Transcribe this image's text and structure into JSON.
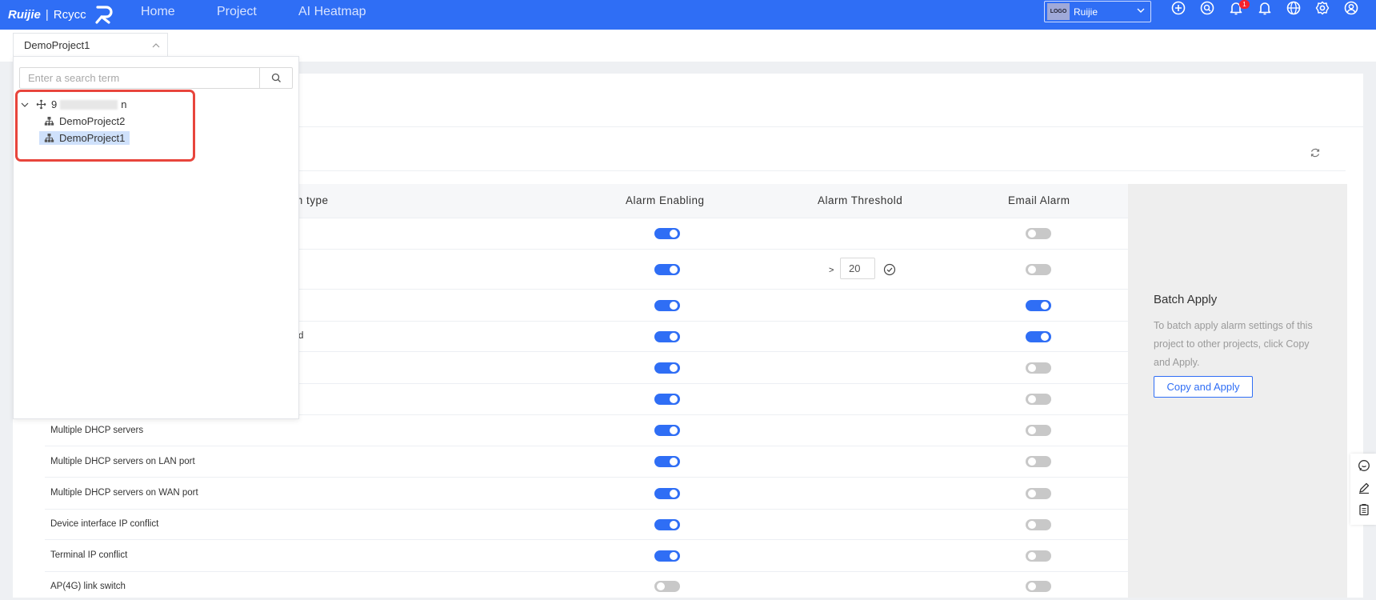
{
  "topbar": {
    "brand": "Ruijie",
    "brand_sub": "Rcycc",
    "nav": [
      "Home",
      "Project",
      "AI Heatmap"
    ],
    "tenant_logo": "LOGO",
    "tenant_name": "Ruijie",
    "notification_count": "1",
    "icons": [
      "add-icon",
      "search-icon",
      "notification-bell-icon",
      "bell-icon",
      "globe-icon",
      "settings-icon",
      "user-icon"
    ],
    "accent": "#2f6ef5"
  },
  "project_selector": {
    "value": "DemoProject1"
  },
  "dropdown": {
    "search_placeholder": "Enter a search term",
    "root_visible_start": "9",
    "root_visible_end": "n",
    "children": [
      "DemoProject2",
      "DemoProject1"
    ],
    "selected": "DemoProject1"
  },
  "table": {
    "headers": {
      "alarm_type_fragment": "rm type",
      "enabling": "Alarm Enabling",
      "threshold": "Alarm Threshold",
      "email": "Email Alarm"
    },
    "rows": [
      {
        "name": "",
        "enabled": true,
        "email": false
      },
      {
        "name": "",
        "enabled": true,
        "email": false,
        "threshold": "20",
        "threshold_op": ">"
      },
      {
        "name": "",
        "enabled": true,
        "email": true
      },
      {
        "name": "d",
        "enabled": true,
        "email": true
      },
      {
        "name": "",
        "enabled": true,
        "email": false
      },
      {
        "name": "",
        "enabled": true,
        "email": false
      },
      {
        "name": "Multiple DHCP servers",
        "enabled": true,
        "email": false
      },
      {
        "name": "Multiple DHCP servers on LAN port",
        "enabled": true,
        "email": false
      },
      {
        "name": "Multiple DHCP servers on WAN port",
        "enabled": true,
        "email": false
      },
      {
        "name": "Device interface IP conflict",
        "enabled": true,
        "email": false
      },
      {
        "name": "Terminal IP conflict",
        "enabled": true,
        "email": false
      },
      {
        "name": "AP(4G) link switch",
        "enabled": false,
        "email": false
      }
    ]
  },
  "batch": {
    "title": "Batch Apply",
    "description": "To batch apply alarm settings of this project to other projects, click Copy and Apply.",
    "button": "Copy and Apply"
  }
}
